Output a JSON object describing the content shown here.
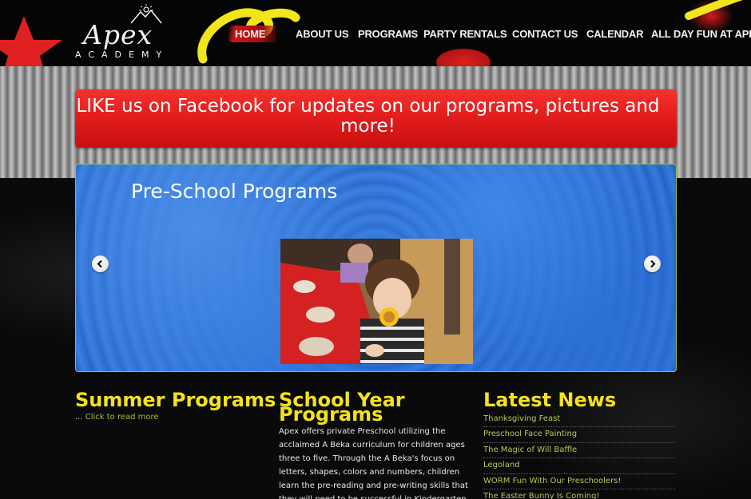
{
  "site": {
    "logo_word": "Apex",
    "logo_sub": "ACADEMY"
  },
  "nav": {
    "items": [
      {
        "label": "HOME",
        "active": true
      },
      {
        "label": "ABOUT US",
        "active": false
      },
      {
        "label": "PROGRAMS",
        "active": false
      },
      {
        "label": "PARTY RENTALS",
        "active": false
      },
      {
        "label": "CONTACT US",
        "active": false
      },
      {
        "label": "CALENDAR",
        "active": false
      },
      {
        "label": "ALL DAY FUN AT APEX!",
        "active": false
      }
    ]
  },
  "banner": {
    "text": "LIKE us on Facebook for updates on our programs, pictures and more!"
  },
  "slider": {
    "title": "Pre-School Programs",
    "prev_icon": "chevron-left-icon",
    "next_icon": "chevron-right-icon"
  },
  "columns": {
    "summer": {
      "heading": "Summer Programs",
      "ellipsis": "...",
      "read_more": "Click to read more"
    },
    "school_year": {
      "heading_line1": "School Year",
      "heading_line2": "Programs",
      "body": "Apex offers private Preschool utilizing the acclaimed A Beka curriculum for children ages three to five. Through the A Beka's focus on letters, shapes, colors and numbers, children learn the pre-reading and pre-writing skills that they will need to be successful in Kindergarten. For our School Aged children, Apex offers"
    },
    "news": {
      "heading": "Latest News",
      "items": [
        "Thanksgiving Feast",
        "Preschool Face Painting",
        "The Magic of Will Baffle",
        "Legoland",
        "WORM Fun With Our Preschoolers!",
        "The Easter Bunny Is Coming!"
      ]
    }
  },
  "colors": {
    "accent_yellow": "#f4e21b",
    "banner_red": "#e41d1d",
    "link_green": "#9fbf3b",
    "slider_blue": "#2a6ad0"
  }
}
